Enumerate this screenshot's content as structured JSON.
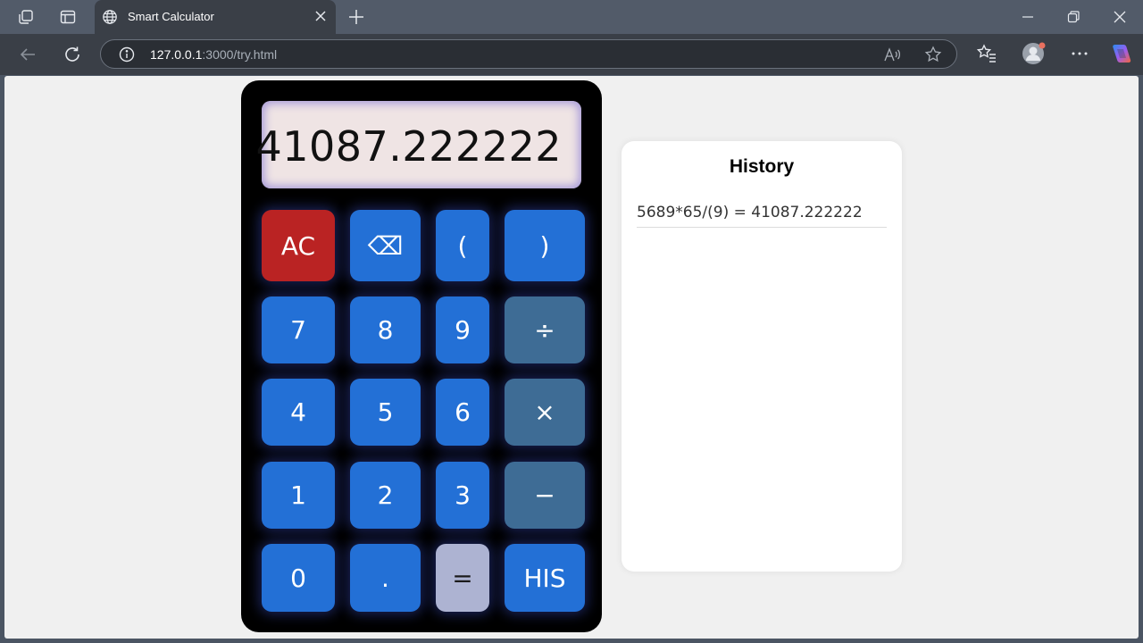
{
  "browser": {
    "tab_title": "Smart Calculator",
    "url_host": "127.0.0.1",
    "url_rest": ":3000/try.html"
  },
  "calculator": {
    "display": "41087.222222",
    "keys": {
      "ac": "AC",
      "backspace": "⌫",
      "open_paren": "(",
      "close_paren": ")",
      "seven": "7",
      "eight": "8",
      "nine": "9",
      "divide": "÷",
      "four": "4",
      "five": "5",
      "six": "6",
      "multiply": "×",
      "one": "1",
      "two": "2",
      "three": "3",
      "minus": "−",
      "zero": "0",
      "dot": ".",
      "equals": "=",
      "history": "HIS"
    }
  },
  "history": {
    "title": "History",
    "entries": [
      "5689*65/(9) = 41087.222222"
    ]
  },
  "colors": {
    "key_blue": "#2370d6",
    "key_red": "#ba2323",
    "key_operator": "#3e6c95",
    "key_equals": "#adb3d2",
    "display_bg": "#efe4e4"
  }
}
